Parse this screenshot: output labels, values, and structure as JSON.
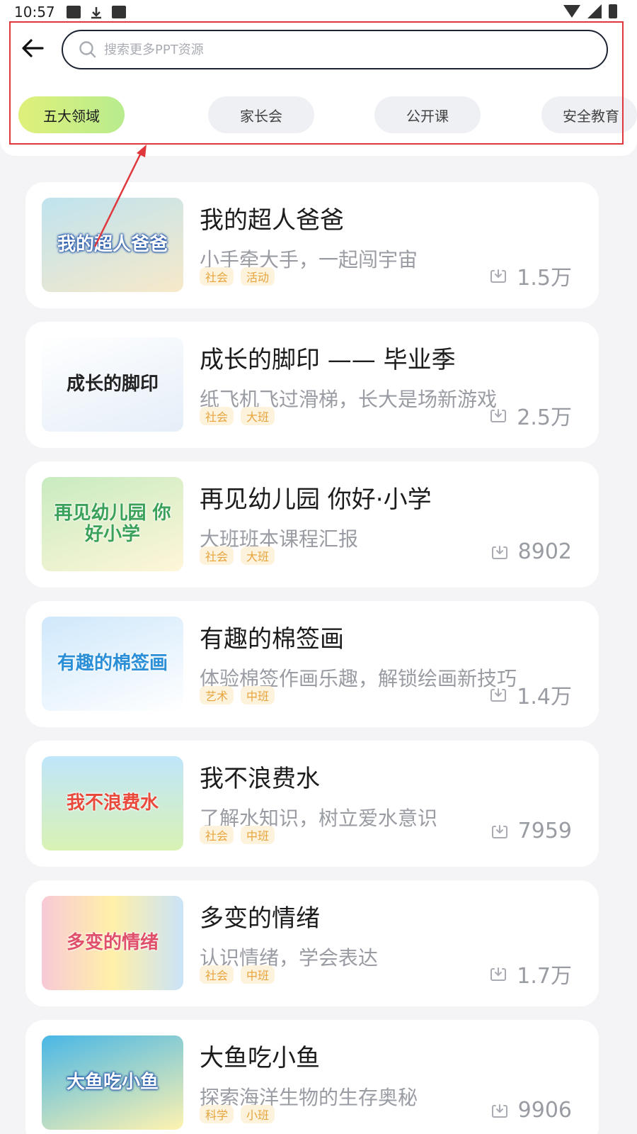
{
  "status_bar": {
    "time": "10:57"
  },
  "search": {
    "placeholder": "搜索更多PPT资源"
  },
  "tabs": [
    {
      "label": "五大领域",
      "active": true
    },
    {
      "label": "家长会",
      "active": false
    },
    {
      "label": "公开课",
      "active": false
    },
    {
      "label": "安全教育",
      "active": false
    }
  ],
  "items": [
    {
      "title": "我的超人爸爸",
      "subtitle": "小手牵大手，一起闯宇宙",
      "tags": [
        "社会",
        "活动"
      ],
      "downloads": "1.5万",
      "thumb_text": "我的超人爸爸",
      "thumb_colors": [
        "#bfe3ef",
        "#f7e9c9"
      ]
    },
    {
      "title": "成长的脚印 —— 毕业季",
      "subtitle": "纸飞机飞过滑梯，长大是场新游戏",
      "tags": [
        "社会",
        "大班"
      ],
      "downloads": "2.5万",
      "thumb_text": "成长的脚印",
      "thumb_colors": [
        "#ffffff",
        "#e5eef8"
      ]
    },
    {
      "title": "再见幼儿园 你好·小学",
      "subtitle": "大班班本课程汇报",
      "tags": [
        "社会",
        "大班"
      ],
      "downloads": "8902",
      "thumb_text": "再见幼儿园 你好小学",
      "thumb_colors": [
        "#c8ebc0",
        "#fff6d9"
      ]
    },
    {
      "title": "有趣的棉签画",
      "subtitle": "体验棉签作画乐趣，解锁绘画新技巧",
      "tags": [
        "艺术",
        "中班"
      ],
      "downloads": "1.4万",
      "thumb_text": "有趣的棉签画",
      "thumb_colors": [
        "#cfe8fb",
        "#ffffff"
      ]
    },
    {
      "title": "我不浪费水",
      "subtitle": "了解水知识，树立爱水意识",
      "tags": [
        "社会",
        "中班"
      ],
      "downloads": "7959",
      "thumb_text": "我不浪费水",
      "thumb_colors": [
        "#bfe6fb",
        "#d9f2b4"
      ]
    },
    {
      "title": "多变的情绪",
      "subtitle": "认识情绪，学会表达",
      "tags": [
        "社会",
        "中班"
      ],
      "downloads": "1.7万",
      "thumb_text": "多变的情绪",
      "thumb_colors": [
        "#f8c9d6",
        "#fff0a8"
      ]
    },
    {
      "title": "大鱼吃小鱼",
      "subtitle": "探索海洋生物的生存奥秘",
      "tags": [
        "科学",
        "小班"
      ],
      "downloads": "9906",
      "thumb_text": "大鱼吃小鱼",
      "thumb_colors": [
        "#49b7e6",
        "#fff3b0"
      ]
    }
  ]
}
